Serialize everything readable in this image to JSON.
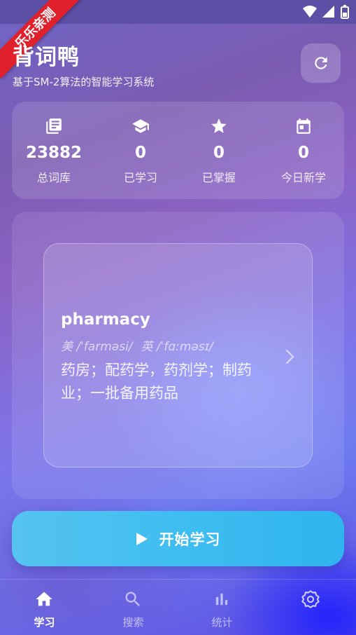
{
  "ribbon_text": "乐乐亲测",
  "header": {
    "title": "背词鸭",
    "subtitle": "基于SM-2算法的智能学习系统"
  },
  "stats": [
    {
      "value": "23882",
      "label": "总词库",
      "icon": "book-icon"
    },
    {
      "value": "0",
      "label": "已学习",
      "icon": "graduation-cap-icon"
    },
    {
      "value": "0",
      "label": "已掌握",
      "icon": "star-icon"
    },
    {
      "value": "0",
      "label": "今日新学",
      "icon": "calendar-icon"
    }
  ],
  "word_card": {
    "word": "pharmacy",
    "us_phonetic": "美 /ˈfarməsi/",
    "uk_phonetic": "英 /ˈfɑːməsɪ/",
    "meaning": "药房；配药学，药剂学；制药业；一批备用药品"
  },
  "start_button": {
    "label": "开始学习"
  },
  "nav": [
    {
      "label": "学习",
      "icon": "home-icon",
      "active": true
    },
    {
      "label": "搜索",
      "icon": "search-icon",
      "active": false
    },
    {
      "label": "统计",
      "icon": "bar-chart-icon",
      "active": false
    },
    {
      "label": "",
      "icon": "settings-icon",
      "active": false
    }
  ],
  "colors": {
    "accent_button": "#3bbcf0",
    "ribbon": "#e0202b"
  }
}
